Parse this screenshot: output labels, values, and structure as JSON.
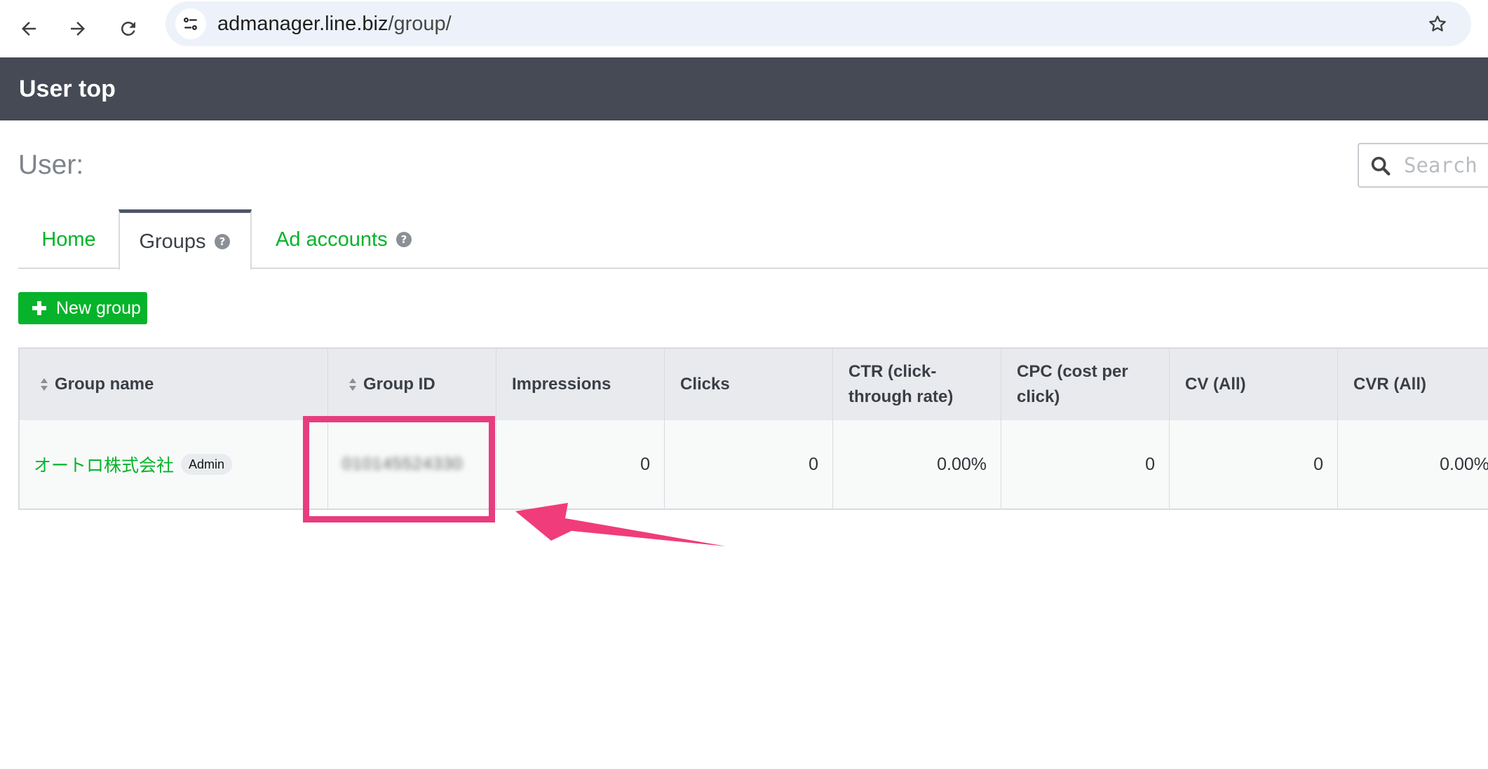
{
  "browser": {
    "url_host": "admanager.line.biz",
    "url_path": "/group/",
    "icons": [
      "back-arrow-icon",
      "forward-arrow-icon",
      "reload-icon",
      "site-settings-icon",
      "bookmark-star-icon"
    ]
  },
  "header": {
    "title": "User top"
  },
  "user": {
    "label": "User:"
  },
  "search": {
    "placeholder": "Search I"
  },
  "tabs": [
    {
      "label": "Home",
      "active": false
    },
    {
      "label": "Groups",
      "active": true,
      "help": true
    },
    {
      "label": "Ad accounts",
      "active": false,
      "help": true
    }
  ],
  "toolbar": {
    "new_group_label": "New group"
  },
  "table": {
    "columns": [
      {
        "label": "Group name",
        "sortable": true
      },
      {
        "label": "Group ID",
        "sortable": true
      },
      {
        "label": "Impressions",
        "sortable": false
      },
      {
        "label": "Clicks",
        "sortable": false
      },
      {
        "label": "CTR (click-through rate)",
        "sortable": false
      },
      {
        "label": "CPC (cost per click)",
        "sortable": false
      },
      {
        "label": "CV (All)",
        "sortable": false
      },
      {
        "label": "CVR (All)",
        "sortable": false
      }
    ],
    "rows": [
      {
        "group_name": "オートロ株式会社",
        "badge": "Admin",
        "group_id": "010145524330",
        "impressions": "0",
        "clicks": "0",
        "ctr": "0.00%",
        "cpc": "0",
        "cv": "0",
        "cvr": "0.00%"
      }
    ]
  },
  "colors": {
    "header_bg": "#454a55",
    "accent_green": "#06b32a",
    "annotation_pink": "#e73c7e"
  }
}
